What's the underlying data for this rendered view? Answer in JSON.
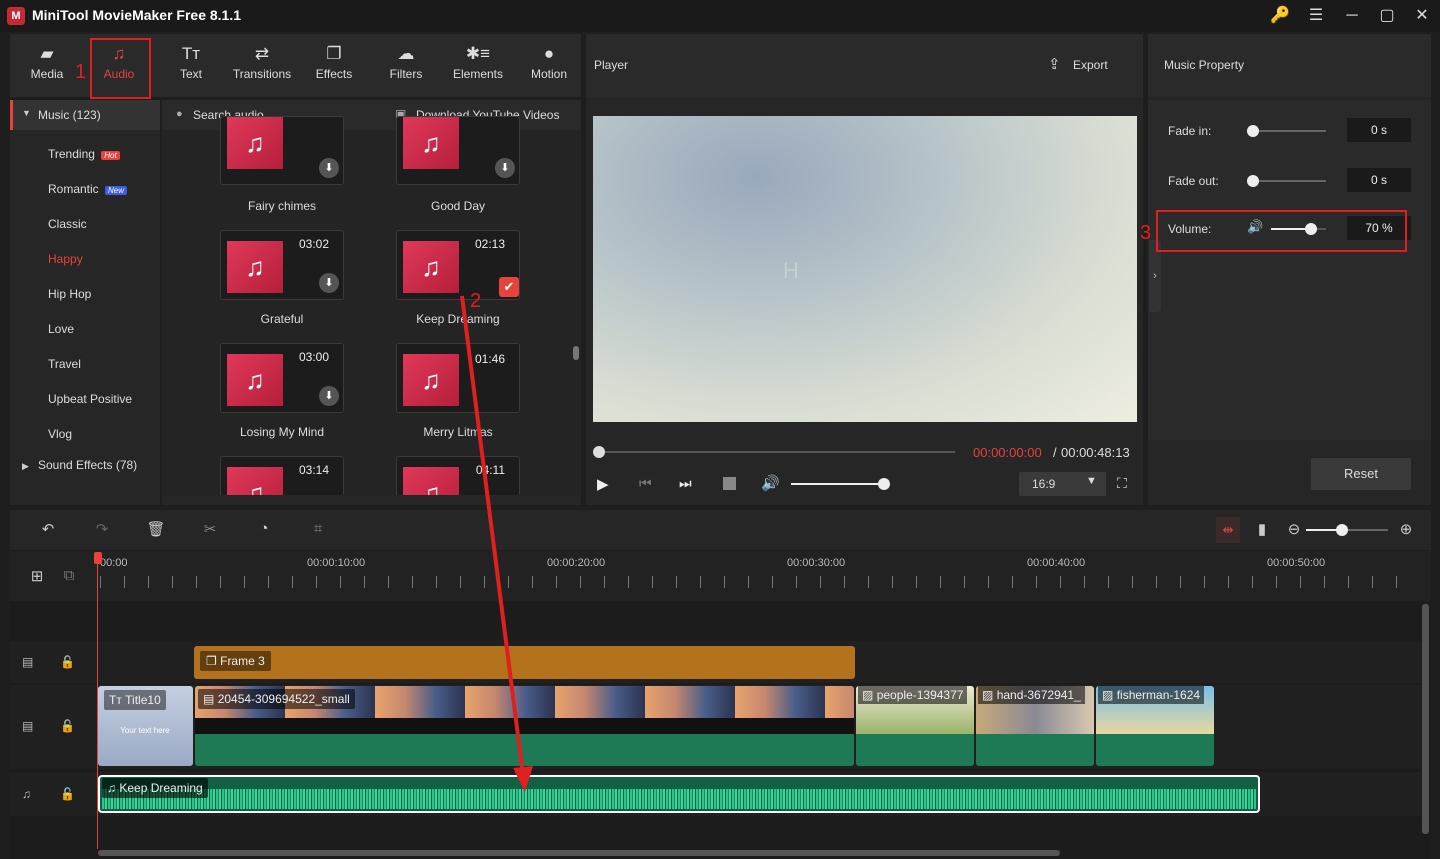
{
  "app": {
    "title": "MiniTool MovieMaker Free 8.1.1",
    "logo": "M"
  },
  "window": {
    "key_icon": "🔑",
    "menu_icon": "☰",
    "min": "─",
    "max": "▢",
    "close": "✕"
  },
  "toolbar": {
    "items": [
      {
        "label": "Media",
        "icon": "▰"
      },
      {
        "label": "Audio",
        "icon": "♫"
      },
      {
        "label": "Text",
        "icon": "Tт"
      },
      {
        "label": "Transitions",
        "icon": "⇄"
      },
      {
        "label": "Effects",
        "icon": "❐"
      },
      {
        "label": "Filters",
        "icon": "☁"
      },
      {
        "label": "Elements",
        "icon": "✱≡"
      },
      {
        "label": "Motion",
        "icon": "●"
      }
    ]
  },
  "annotations": {
    "n1": "1",
    "n2": "2",
    "n3": "3"
  },
  "library": {
    "music_header": "Music (123)",
    "categories": [
      "Trending",
      "Romantic",
      "Classic",
      "Happy",
      "Hip Hop",
      "Love",
      "Travel",
      "Upbeat Positive",
      "Vlog"
    ],
    "badge_hot": "Hot",
    "badge_new": "New",
    "sound_effects": "Sound Effects (78)",
    "search_placeholder": "Search audio",
    "download_youtube": "Download YouTube Videos",
    "clips": [
      {
        "name": "Fairy chimes",
        "duration": ""
      },
      {
        "name": "Good Day",
        "duration": ""
      },
      {
        "name": "Grateful",
        "duration": "03:02"
      },
      {
        "name": "Keep Dreaming",
        "duration": "02:13"
      },
      {
        "name": "Losing My Mind",
        "duration": "03:00"
      },
      {
        "name": "Merry Litmas",
        "duration": "01:46"
      },
      {
        "name": "",
        "duration": "03:14"
      },
      {
        "name": "",
        "duration": "04:11"
      }
    ]
  },
  "player": {
    "title": "Player",
    "export": "Export",
    "current_time": "00:00:00:00",
    "sep": "/",
    "total_time": "00:00:48:13",
    "aspect": "16:9",
    "watermark": "H",
    "progress": 0,
    "volume": 1.0
  },
  "music_property": {
    "title": "Music Property",
    "fade_in_label": "Fade in:",
    "fade_in_value": "0 s",
    "fade_in": 0,
    "fade_out_label": "Fade out:",
    "fade_out_value": "0 s",
    "fade_out": 0,
    "volume_label": "Volume:",
    "volume_value": "70 %",
    "volume": 0.7,
    "reset": "Reset"
  },
  "timeline": {
    "ruler": [
      "00:00",
      "00:00:10:00",
      "00:00:20:00",
      "00:00:30:00",
      "00:00:40:00",
      "00:00:50:00"
    ],
    "frame_clip": "Frame 3",
    "title_clip": "Title10",
    "title_sub": "Your text here",
    "video_clips": [
      "20454-309694522_small",
      "people-1394377",
      "hand-3672941_",
      "fisherman-1624"
    ],
    "audio_clip": "Keep Dreaming",
    "zoom": 0.5
  },
  "colors": {
    "accent": "#e8423c",
    "audio_green": "#2aa778",
    "video_green": "#1e7a55",
    "frame_orange": "#b5721c",
    "annotation_red": "#e02020"
  }
}
